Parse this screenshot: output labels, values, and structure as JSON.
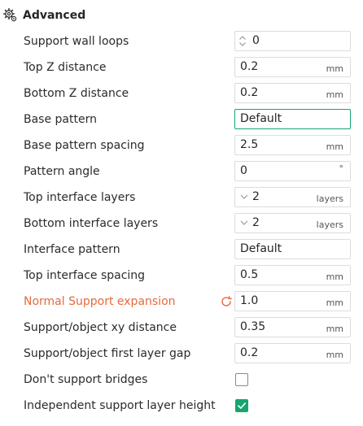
{
  "section": {
    "title": "Advanced",
    "icon": "gear-icon"
  },
  "colors": {
    "accent": "#15a56d",
    "modified_label": "#e7693b",
    "field_border": "#dcdcdc"
  },
  "settings": [
    {
      "label": "Support wall loops",
      "control": "spin",
      "value": "0"
    },
    {
      "label": "Top Z distance",
      "control": "number",
      "value": "0.2",
      "unit": "mm"
    },
    {
      "label": "Bottom Z distance",
      "control": "number",
      "value": "0.2",
      "unit": "mm"
    },
    {
      "label": "Base pattern",
      "control": "select",
      "value": "Default",
      "focused": true
    },
    {
      "label": "Base pattern spacing",
      "control": "number",
      "value": "2.5",
      "unit": "mm"
    },
    {
      "label": "Pattern angle",
      "control": "number",
      "value": "0",
      "unit": "°"
    },
    {
      "label": "Top interface layers",
      "control": "combo",
      "value": "2",
      "unit": "layers"
    },
    {
      "label": "Bottom interface layers",
      "control": "combo",
      "value": "2",
      "unit": "layers"
    },
    {
      "label": "Interface pattern",
      "control": "select",
      "value": "Default"
    },
    {
      "label": "Top interface spacing",
      "control": "number",
      "value": "0.5",
      "unit": "mm"
    },
    {
      "label": "Normal Support expansion",
      "control": "number",
      "value": "1.0",
      "unit": "mm",
      "modified": true
    },
    {
      "label": "Support/object xy distance",
      "control": "number",
      "value": "0.35",
      "unit": "mm"
    },
    {
      "label": "Support/object first layer gap",
      "control": "number",
      "value": "0.2",
      "unit": "mm"
    },
    {
      "label": "Don't support bridges",
      "control": "checkbox",
      "checked": false
    },
    {
      "label": "Independent support layer height",
      "control": "checkbox",
      "checked": true
    }
  ]
}
